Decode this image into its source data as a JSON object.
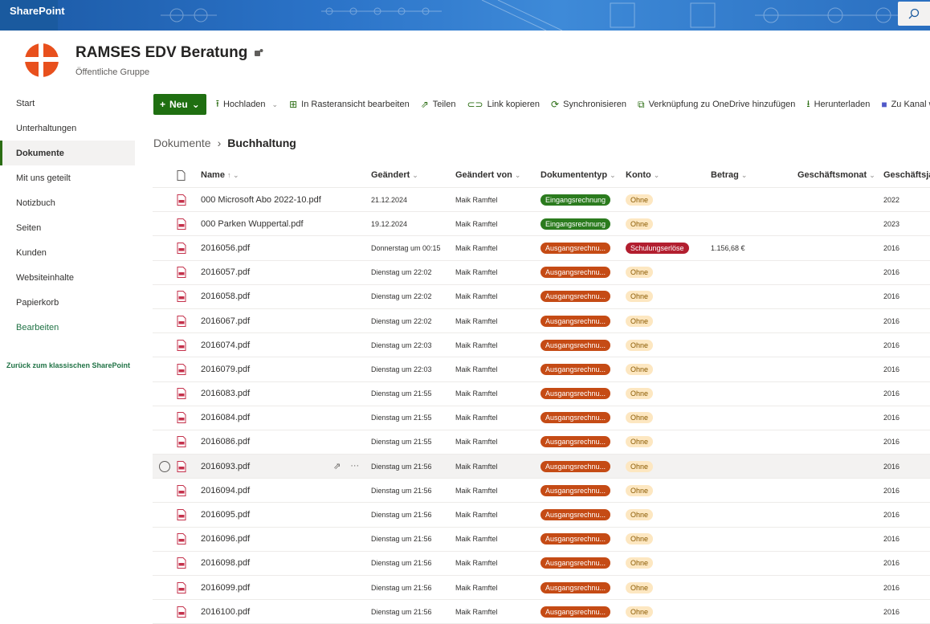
{
  "topbar": {
    "brand": "SharePoint"
  },
  "site": {
    "title": "RAMSES EDV Beratung",
    "subtitle": "Öffentliche Gruppe"
  },
  "nav": {
    "items": [
      {
        "label": "Start"
      },
      {
        "label": "Unterhaltungen"
      },
      {
        "label": "Dokumente",
        "selected": true
      },
      {
        "label": "Mit uns geteilt"
      },
      {
        "label": "Notizbuch"
      },
      {
        "label": "Seiten"
      },
      {
        "label": "Kunden"
      },
      {
        "label": "Websiteinhalte"
      },
      {
        "label": "Papierkorb"
      }
    ],
    "edit": "Bearbeiten",
    "back": "Zurück zum klassischen SharePoint"
  },
  "toolbar": {
    "new": "Neu",
    "upload": "Hochladen",
    "grid": "In Rasteransicht bearbeiten",
    "share": "Teilen",
    "copylink": "Link kopieren",
    "sync": "Synchronisieren",
    "onedrive": "Verknüpfung zu OneDrive hinzufügen",
    "download": "Herunterladen",
    "channel": "Zu Kanal wechseln"
  },
  "breadcrumb": {
    "root": "Dokumente",
    "current": "Buchhaltung"
  },
  "columns": {
    "name": "Name",
    "modified": "Geändert",
    "modified_by": "Geändert von",
    "doctype": "Dokumententyp",
    "konto": "Konto",
    "betrag": "Betrag",
    "monat": "Geschäftsmonat",
    "jahr": "Geschäftsjahr"
  },
  "rows": [
    {
      "name": "000 Microsoft Abo 2022-10.pdf",
      "modified": "21.12.2024",
      "by": "Maik Ramftel",
      "type": "Eingangsrechnung",
      "type_class": "ein",
      "konto": "Ohne",
      "konto_class": "ohne",
      "betrag": "",
      "jahr": "2022"
    },
    {
      "name": "000 Parken Wuppertal.pdf",
      "modified": "19.12.2024",
      "by": "Maik Ramftel",
      "type": "Eingangsrechnung",
      "type_class": "ein",
      "konto": "Ohne",
      "konto_class": "ohne",
      "betrag": "",
      "jahr": "2023"
    },
    {
      "name": "2016056.pdf",
      "modified": "Donnerstag um 00:15",
      "by": "Maik Ramftel",
      "type": "Ausgangsrechnu...",
      "type_class": "aus",
      "konto": "Schulungserlöse",
      "konto_class": "schul",
      "betrag": "1.156,68 €",
      "jahr": "2016"
    },
    {
      "name": "2016057.pdf",
      "modified": "Dienstag um 22:02",
      "by": "Maik Ramftel",
      "type": "Ausgangsrechnu...",
      "type_class": "aus",
      "konto": "Ohne",
      "konto_class": "ohne",
      "betrag": "",
      "jahr": "2016"
    },
    {
      "name": "2016058.pdf",
      "modified": "Dienstag um 22:02",
      "by": "Maik Ramftel",
      "type": "Ausgangsrechnu...",
      "type_class": "aus",
      "konto": "Ohne",
      "konto_class": "ohne",
      "betrag": "",
      "jahr": "2016"
    },
    {
      "name": "2016067.pdf",
      "modified": "Dienstag um 22:02",
      "by": "Maik Ramftel",
      "type": "Ausgangsrechnu...",
      "type_class": "aus",
      "konto": "Ohne",
      "konto_class": "ohne",
      "betrag": "",
      "jahr": "2016"
    },
    {
      "name": "2016074.pdf",
      "modified": "Dienstag um 22:03",
      "by": "Maik Ramftel",
      "type": "Ausgangsrechnu...",
      "type_class": "aus",
      "konto": "Ohne",
      "konto_class": "ohne",
      "betrag": "",
      "jahr": "2016"
    },
    {
      "name": "2016079.pdf",
      "modified": "Dienstag um 22:03",
      "by": "Maik Ramftel",
      "type": "Ausgangsrechnu...",
      "type_class": "aus",
      "konto": "Ohne",
      "konto_class": "ohne",
      "betrag": "",
      "jahr": "2016"
    },
    {
      "name": "2016083.pdf",
      "modified": "Dienstag um 21:55",
      "by": "Maik Ramftel",
      "type": "Ausgangsrechnu...",
      "type_class": "aus",
      "konto": "Ohne",
      "konto_class": "ohne",
      "betrag": "",
      "jahr": "2016"
    },
    {
      "name": "2016084.pdf",
      "modified": "Dienstag um 21:55",
      "by": "Maik Ramftel",
      "type": "Ausgangsrechnu...",
      "type_class": "aus",
      "konto": "Ohne",
      "konto_class": "ohne",
      "betrag": "",
      "jahr": "2016"
    },
    {
      "name": "2016086.pdf",
      "modified": "Dienstag um 21:55",
      "by": "Maik Ramftel",
      "type": "Ausgangsrechnu...",
      "type_class": "aus",
      "konto": "Ohne",
      "konto_class": "ohne",
      "betrag": "",
      "jahr": "2016"
    },
    {
      "name": "2016093.pdf",
      "modified": "Dienstag um 21:56",
      "by": "Maik Ramftel",
      "type": "Ausgangsrechnu...",
      "type_class": "aus",
      "konto": "Ohne",
      "konto_class": "ohne",
      "betrag": "",
      "jahr": "2016",
      "hover": true
    },
    {
      "name": "2016094.pdf",
      "modified": "Dienstag um 21:56",
      "by": "Maik Ramftel",
      "type": "Ausgangsrechnu...",
      "type_class": "aus",
      "konto": "Ohne",
      "konto_class": "ohne",
      "betrag": "",
      "jahr": "2016"
    },
    {
      "name": "2016095.pdf",
      "modified": "Dienstag um 21:56",
      "by": "Maik Ramftel",
      "type": "Ausgangsrechnu...",
      "type_class": "aus",
      "konto": "Ohne",
      "konto_class": "ohne",
      "betrag": "",
      "jahr": "2016"
    },
    {
      "name": "2016096.pdf",
      "modified": "Dienstag um 21:56",
      "by": "Maik Ramftel",
      "type": "Ausgangsrechnu...",
      "type_class": "aus",
      "konto": "Ohne",
      "konto_class": "ohne",
      "betrag": "",
      "jahr": "2016"
    },
    {
      "name": "2016098.pdf",
      "modified": "Dienstag um 21:56",
      "by": "Maik Ramftel",
      "type": "Ausgangsrechnu...",
      "type_class": "aus",
      "konto": "Ohne",
      "konto_class": "ohne",
      "betrag": "",
      "jahr": "2016"
    },
    {
      "name": "2016099.pdf",
      "modified": "Dienstag um 21:56",
      "by": "Maik Ramftel",
      "type": "Ausgangsrechnu...",
      "type_class": "aus",
      "konto": "Ohne",
      "konto_class": "ohne",
      "betrag": "",
      "jahr": "2016"
    },
    {
      "name": "2016100.pdf",
      "modified": "Dienstag um 21:56",
      "by": "Maik Ramftel",
      "type": "Ausgangsrechnu...",
      "type_class": "aus",
      "konto": "Ohne",
      "konto_class": "ohne",
      "betrag": "",
      "jahr": "2016"
    }
  ]
}
